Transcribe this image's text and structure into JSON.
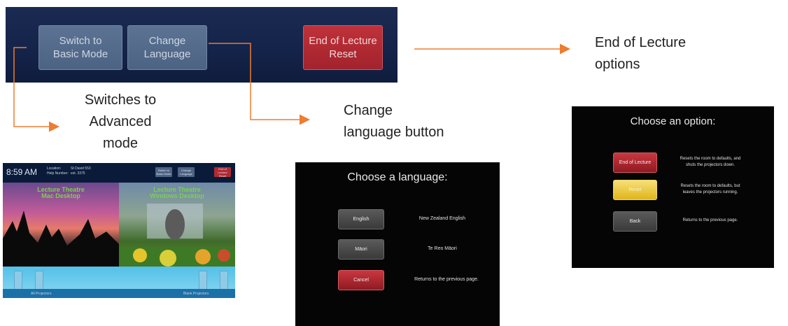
{
  "top_bar": {
    "switch_label": "Switch to\nBasic Mode",
    "language_label": "Change\nLanguage",
    "end_label": "End of Lecture\nReset"
  },
  "captions": {
    "end_of_lecture": "End of Lecture\noptions",
    "switches": "Switches to\nAdvanced\nmode",
    "change_language": "Change\nlanguage button"
  },
  "advanced_panel": {
    "time": "8:59 AM",
    "location_label": "Location:",
    "location_value": "St David 553",
    "help_label": "Help Number:",
    "help_value": "ext. 3375",
    "switch_btn": "Switch to Basic Mode",
    "language_btn": "Change Language",
    "end_btn": "End of Lecture Reset",
    "left_source_title": "Lecture Theatre\nMac Desktop",
    "right_source_title": "Lecture Theatre\nWindows Desktop",
    "left_footer": "All Projectors",
    "right_footer": "Blank Projectors"
  },
  "language_dialog": {
    "title": "Choose a language:",
    "options": [
      {
        "button": "English",
        "description": "New Zealand English"
      },
      {
        "button": "Māori",
        "description": "Te Reo Māori"
      },
      {
        "button": "Cancel",
        "description": "Returns to the previous page."
      }
    ]
  },
  "option_dialog": {
    "title": "Choose an option:",
    "options": [
      {
        "button": "End of Lecture",
        "description": "Resets the room to defaults, and\nshuts the projectors down."
      },
      {
        "button": "Reset",
        "description": "Resets the room to defaults, but\nleaves the projectors running."
      },
      {
        "button": "Back",
        "description": "Returns to the previous page."
      }
    ]
  },
  "colors": {
    "connector": "#ed7d31",
    "topbar_bg": "#142349",
    "red_button": "#b02a32",
    "yellow_button": "#e8c640"
  }
}
